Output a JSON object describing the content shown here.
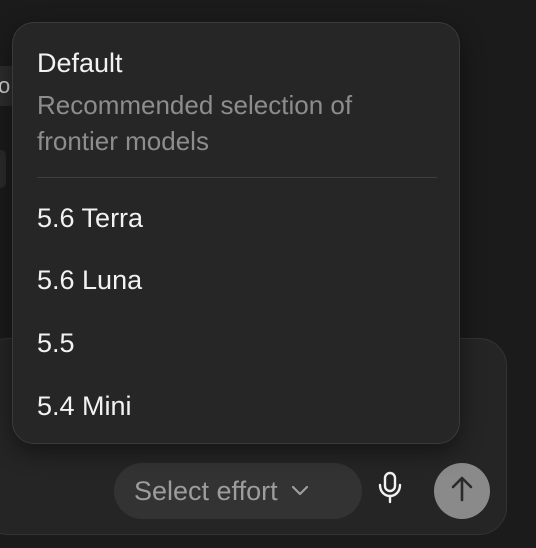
{
  "menu": {
    "default": {
      "title": "Default",
      "description": "Recommended selection of frontier models"
    },
    "items": [
      {
        "label": "5.6 Terra"
      },
      {
        "label": "5.6 Luna"
      },
      {
        "label": "5.5"
      },
      {
        "label": "5.4 Mini"
      }
    ]
  },
  "composer": {
    "effort_button_label": "Select effort",
    "icons": {
      "effort": "chevron-down-icon",
      "mic": "microphone-icon",
      "send": "arrow-up-icon"
    }
  },
  "background": {
    "fragment_text": "o"
  },
  "colors": {
    "page_background": "#1b1b1b",
    "menu_background": "#262626",
    "composer_background": "#252525",
    "pill_background": "#333333",
    "send_button": "#8a8a8a",
    "primary_text": "#f2f2f2",
    "secondary_text": "#8d8d8d"
  }
}
